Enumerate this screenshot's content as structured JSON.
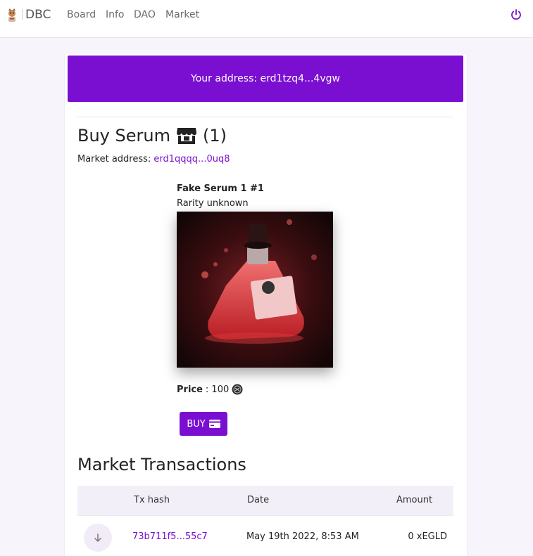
{
  "nav": {
    "brand": "DBC",
    "links": [
      "Board",
      "Info",
      "DAO",
      "Market"
    ],
    "icons": {
      "logo": "dog-avatar-logo",
      "logout": "power-icon"
    },
    "accent_color": "#7a0fd2"
  },
  "banner": {
    "address_text": "Your address: erd1tzq4...4vgw"
  },
  "buy": {
    "title": "Buy Serum",
    "count": "(1)",
    "store_icon": "store-icon",
    "market_label": "Market address: ",
    "market_address": "erd1qqqq...0uq8"
  },
  "nft": {
    "name": "Fake Serum 1 #1",
    "rarity": "Rarity unknown",
    "price_label": "Price",
    "price_value": ": 100",
    "currency_icon": "egld-icon",
    "buy_label": "BUY",
    "buy_icon": "credit-card-icon"
  },
  "transactions": {
    "title": "Market Transactions",
    "columns": [
      "Tx hash",
      "Date",
      "Amount"
    ],
    "rows": [
      {
        "direction_icon": "arrow-down-icon",
        "hash": "73b711f5...55c7",
        "date": "May 19th 2022, 8:53 AM",
        "amount": "0 xEGLD"
      }
    ]
  }
}
